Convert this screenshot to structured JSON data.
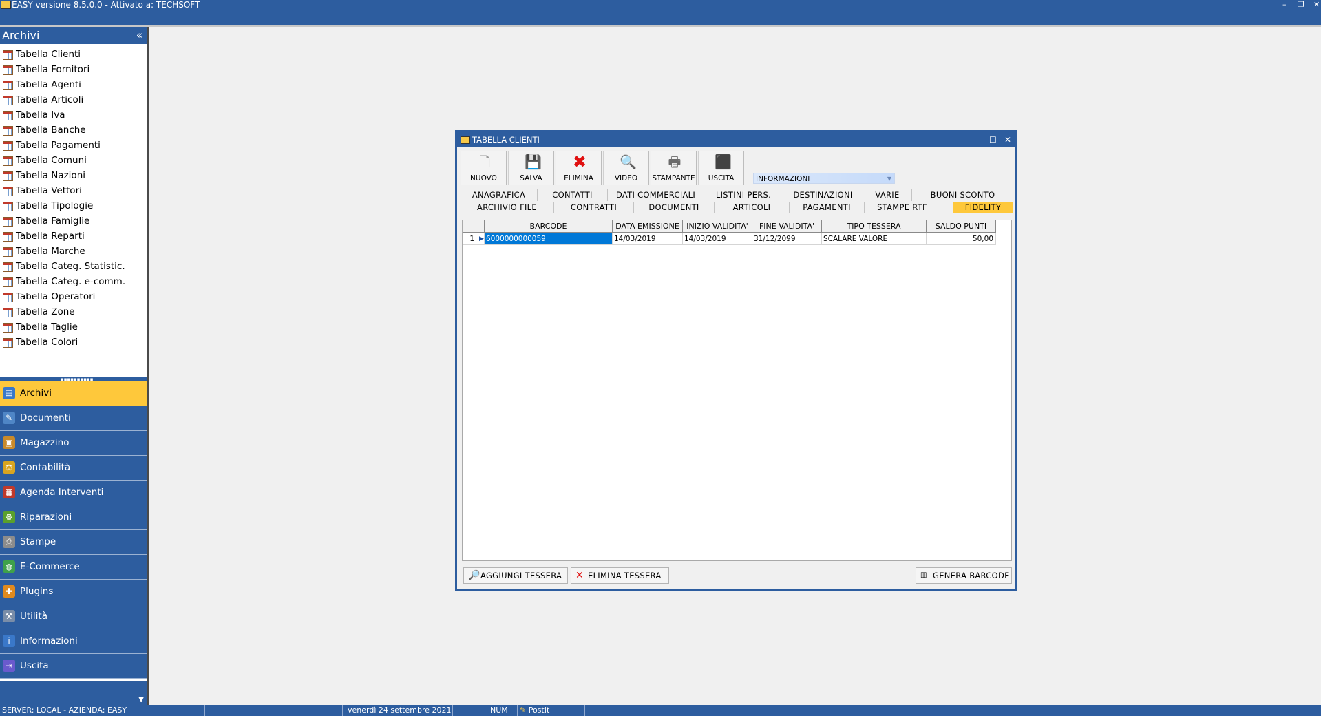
{
  "app": {
    "title": "EASY versione 8.5.0.0 - Attivato a: TECHSOFT",
    "window_controls": [
      "–",
      "❐",
      "✕"
    ]
  },
  "sidebar": {
    "header": "Archivi",
    "collapse_glyph": "«",
    "items": [
      {
        "label": "Tabella Clienti"
      },
      {
        "label": "Tabella Fornitori"
      },
      {
        "label": "Tabella Agenti"
      },
      {
        "label": "Tabella Articoli"
      },
      {
        "label": "Tabella Iva"
      },
      {
        "label": "Tabella Banche"
      },
      {
        "label": "Tabella Pagamenti"
      },
      {
        "label": "Tabella Comuni"
      },
      {
        "label": "Tabella Nazioni"
      },
      {
        "label": "Tabella Vettori"
      },
      {
        "label": "Tabella Tipologie"
      },
      {
        "label": "Tabella Famiglie"
      },
      {
        "label": "Tabella Reparti"
      },
      {
        "label": "Tabella Marche"
      },
      {
        "label": "Tabella Categ. Statistic."
      },
      {
        "label": "Tabella Categ. e-comm."
      },
      {
        "label": "Tabella Operatori"
      },
      {
        "label": "Tabella Zone"
      },
      {
        "label": "Tabella Taglie"
      },
      {
        "label": "Tabella Colori"
      }
    ],
    "nav": [
      {
        "label": "Archivi",
        "icon": "archive-icon",
        "color": "#3a78c9",
        "active": true
      },
      {
        "label": "Documenti",
        "icon": "document-icon",
        "color": "#4f86c6"
      },
      {
        "label": "Magazzino",
        "icon": "box-icon",
        "color": "#c98a2b"
      },
      {
        "label": "Contabilità",
        "icon": "scale-icon",
        "color": "#d9a520"
      },
      {
        "label": "Agenda Interventi",
        "icon": "calendar-icon",
        "color": "#c0392b"
      },
      {
        "label": "Riparazioni",
        "icon": "repair-icon",
        "color": "#5aa02c"
      },
      {
        "label": "Stampe",
        "icon": "printer-icon",
        "color": "#8c8c8c"
      },
      {
        "label": "E-Commerce",
        "icon": "globe-icon",
        "color": "#3fa14a"
      },
      {
        "label": "Plugins",
        "icon": "plugin-icon",
        "color": "#e08a1e"
      },
      {
        "label": "Utilità",
        "icon": "tools-icon",
        "color": "#7a8da8"
      },
      {
        "label": "Informazioni",
        "icon": "info-icon",
        "color": "#3a78c9"
      },
      {
        "label": "Uscita",
        "icon": "exit-icon",
        "color": "#6a5acd"
      }
    ]
  },
  "statusbar": {
    "server": "SERVER: LOCAL - AZIENDA: EASY",
    "date": "venerdì 24 settembre 2021",
    "num": "NUM",
    "postit": "PostIt"
  },
  "dialog": {
    "title": "TABELLA CLIENTI",
    "controls": [
      "–",
      "☐",
      "✕"
    ],
    "toolbar": [
      {
        "label": "NUOVO",
        "icon": "new-document-icon"
      },
      {
        "label": "SALVA",
        "icon": "floppy-icon"
      },
      {
        "label": "ELIMINA",
        "icon": "delete-x-icon"
      },
      {
        "label": "VIDEO",
        "icon": "preview-icon"
      },
      {
        "label": "STAMPANTE",
        "icon": "printer-icon"
      },
      {
        "label": "USCITA",
        "icon": "exit-door-icon"
      }
    ],
    "info_dropdown": "INFORMAZIONI",
    "tabs_row1": [
      "ANAGRAFICA",
      "CONTATTI",
      "DATI COMMERCIALI",
      "LISTINI PERS.",
      "DESTINAZIONI",
      "VARIE",
      "BUONI SCONTO"
    ],
    "tabs_row2": [
      "ARCHIVIO FILE",
      "CONTRATTI",
      "DOCUMENTI",
      "ARTICOLI",
      "PAGAMENTI",
      "STAMPE RTF",
      "FIDELITY"
    ],
    "active_tab": "FIDELITY",
    "grid": {
      "headers": [
        "BARCODE",
        "DATA EMISSIONE",
        "INIZIO VALIDITA'",
        "FINE VALIDITA'",
        "TIPO TESSERA",
        "SALDO PUNTI"
      ],
      "rows": [
        {
          "n": "1",
          "barcode": "6000000000059",
          "emissione": "14/03/2019",
          "inizio": "14/03/2019",
          "fine": "31/12/2099",
          "tipo": "SCALARE VALORE",
          "saldo": "50,00"
        }
      ]
    },
    "buttons": {
      "add": "AGGIUNGI TESSERA",
      "delete": "ELIMINA TESSERA",
      "barcode": "GENERA BARCODE"
    }
  }
}
